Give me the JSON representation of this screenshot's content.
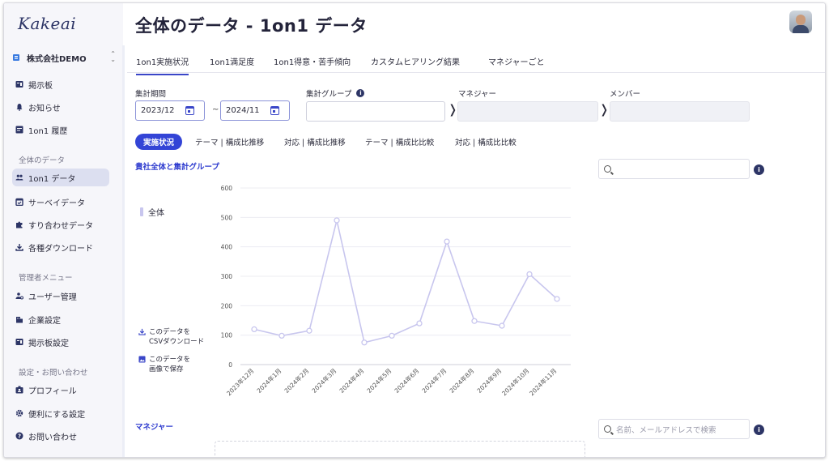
{
  "app": {
    "logo": "Kakeai",
    "page_title": "全体のデータ - 1on1 データ"
  },
  "sidebar": {
    "company": "株式会社DEMO",
    "items_top": [
      {
        "label": "掲示板",
        "icon": "bulletin-board-icon"
      },
      {
        "label": "お知らせ",
        "icon": "bell-icon"
      },
      {
        "label": "1on1 履歴",
        "icon": "history-icon"
      }
    ],
    "section_data": "全体のデータ",
    "items_data": [
      {
        "label": "1on1 データ",
        "icon": "people-icon",
        "active": true
      },
      {
        "label": "サーベイデータ",
        "icon": "survey-icon"
      },
      {
        "label": "すり合わせデータ",
        "icon": "puzzle-icon"
      },
      {
        "label": "各種ダウンロード",
        "icon": "download-icon"
      }
    ],
    "section_admin": "管理者メニュー",
    "items_admin": [
      {
        "label": "ユーザー管理",
        "icon": "user-settings-icon"
      },
      {
        "label": "企業設定",
        "icon": "building-icon"
      },
      {
        "label": "掲示板設定",
        "icon": "board-settings-icon"
      }
    ],
    "section_settings": "設定・お問い合わせ",
    "items_settings": [
      {
        "label": "プロフィール",
        "icon": "profile-icon"
      },
      {
        "label": "便利にする設定",
        "icon": "gear-icon"
      },
      {
        "label": "お問い合わせ",
        "icon": "help-icon"
      }
    ]
  },
  "tabs": [
    "1on1実施状況",
    "1on1満足度",
    "1on1得意・苦手傾向",
    "カスタムヒアリング結果",
    "マネジャーごと"
  ],
  "filters": {
    "period_label": "集計期間",
    "start_date": "2023/12",
    "end_date": "2024/11",
    "tilde": "~",
    "group_label": "集計グループ",
    "manager_label": "マネジャー",
    "member_label": "メンバー"
  },
  "subtabs": [
    "実施状況",
    "テーマ | 構成比推移",
    "対応 | 構成比推移",
    "テーマ | 構成比比較",
    "対応 | 構成比比較"
  ],
  "chart_section": {
    "title": "貴社全体と集計グループ",
    "search_placeholder": "",
    "legend": "全体",
    "csv_action": [
      "このデータを",
      "CSVダウンロード"
    ],
    "image_action": [
      "このデータを",
      "画像で保存"
    ]
  },
  "manager_section": {
    "title": "マネジャー",
    "search_placeholder": "名前、メールアドレスで検索"
  },
  "colors": {
    "accent": "#3344d6",
    "line": "#c8c6ee",
    "sidebar_bg": "#f6f6fa"
  },
  "chart_data": {
    "type": "line",
    "categories": [
      "2023年12月",
      "2024年1月",
      "2024年2月",
      "2024年3月",
      "2024年4月",
      "2024年5月",
      "2024年6月",
      "2024年7月",
      "2024年8月",
      "2024年9月",
      "2024年10月",
      "2024年11月"
    ],
    "series": [
      {
        "name": "全体",
        "values": [
          120,
          98,
          115,
          490,
          75,
          98,
          140,
          418,
          148,
          132,
          307,
          223
        ]
      }
    ],
    "ylim": [
      0,
      600
    ],
    "yticks": [
      0,
      100,
      200,
      300,
      400,
      500,
      600
    ],
    "grid": true,
    "legend_position": "left"
  }
}
